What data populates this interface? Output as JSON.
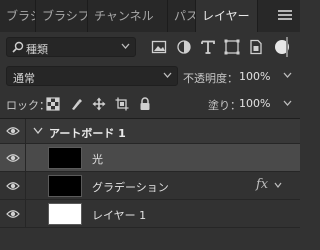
{
  "tabs": [
    {
      "label": "ブラシ"
    },
    {
      "label": "ブラシプリ"
    },
    {
      "label": "チャンネル"
    },
    {
      "label": "パス"
    },
    {
      "label": "レイヤー",
      "active": true
    }
  ],
  "filter": {
    "label": "種類"
  },
  "blend": {
    "mode": "通常",
    "opacity_label": "不透明度：",
    "opacity_value": "100%"
  },
  "lock": {
    "label": "ロック：",
    "fill_label": "塗り：",
    "fill_value": "100%"
  },
  "layers": {
    "artboard_name": "アートボード 1",
    "items": [
      {
        "name": "光",
        "selected": true,
        "thumb": "black"
      },
      {
        "name": "グラデーション",
        "thumb": "black",
        "fx": "fx"
      },
      {
        "name": "レイヤー 1",
        "thumb": "white"
      }
    ]
  },
  "colors": {
    "panel": "#323232",
    "tabbar": "#282828",
    "selected_row": "#4a4a4a"
  }
}
